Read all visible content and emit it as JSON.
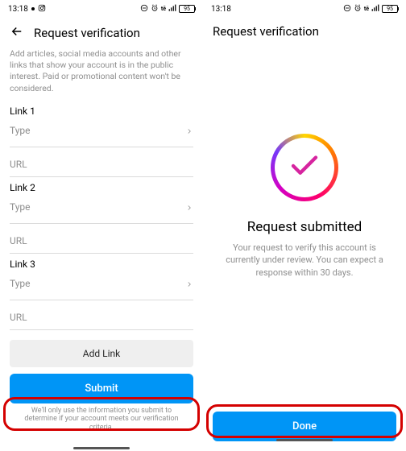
{
  "status": {
    "time": "13:18",
    "battery": "95"
  },
  "left": {
    "title": "Request verification",
    "subtext": "Add articles, social media accounts and other links that show your account is in the public interest. Paid or promotional content won't be considered.",
    "link1": "Link 1",
    "link2": "Link 2",
    "link3": "Link 3",
    "type": "Type",
    "url": "URL",
    "add_link": "Add Link",
    "submit": "Submit",
    "footer": "We'll only use the information you submit to determine if your account meets our verification criteria."
  },
  "right": {
    "title": "Request verification",
    "success_title": "Request submitted",
    "success_sub": "Your request to verify this account is currently under review. You can expect a response within 30 days.",
    "done": "Done"
  }
}
